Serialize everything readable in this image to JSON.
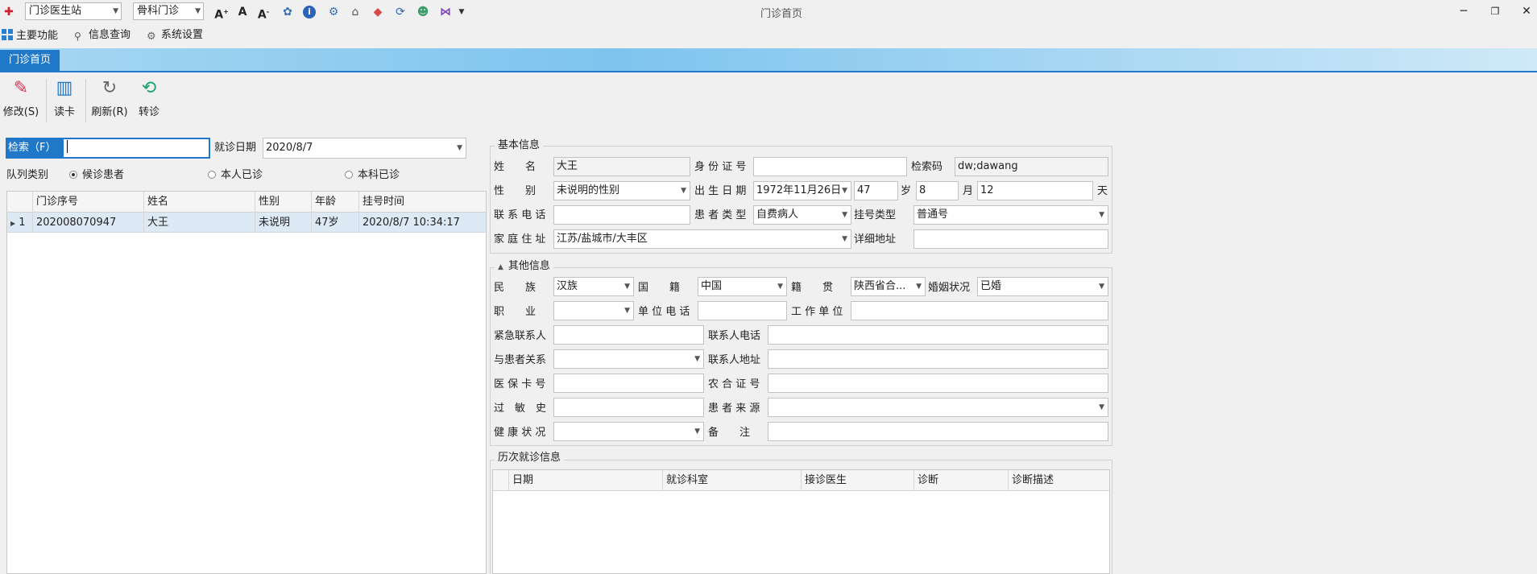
{
  "titlebar": {
    "station": "门诊医生站",
    "department": "骨科门诊",
    "window_title": "门诊首页",
    "icons": [
      "app-logo-icon",
      "font-larger-icon",
      "font-normal-icon",
      "font-smaller-icon",
      "skin-icon",
      "info-icon",
      "settings-icon",
      "home-icon",
      "eraser-icon",
      "sync-icon",
      "user-group-icon",
      "vs-icon"
    ]
  },
  "menubar": {
    "main": "主要功能",
    "query": "信息查询",
    "settings": "系统设置"
  },
  "tabs": {
    "home": "门诊首页"
  },
  "toolbar": {
    "edit": "修改(S)",
    "read_card": "读卡",
    "refresh": "刷新(R)",
    "transfer": "转诊"
  },
  "search": {
    "label": "检索（F）",
    "value": "",
    "date_label": "就诊日期",
    "date_value": "2020/8/7"
  },
  "queue": {
    "label": "队列类别",
    "options": [
      "候诊患者",
      "本人已诊",
      "本科已诊"
    ],
    "selected": 0
  },
  "grid": {
    "columns": [
      "门诊序号",
      "姓名",
      "性别",
      "年龄",
      "挂号时间"
    ],
    "rows": [
      {
        "index": "1",
        "no": "202008070947",
        "name": "大王",
        "sex": "未说明",
        "age": "47岁",
        "time": "2020/8/7 10:34:17"
      }
    ]
  },
  "basic": {
    "title": "基本信息",
    "name_label": "姓　　名",
    "name": "大王",
    "id_label": "身 份 证 号",
    "id": "",
    "code_label": "检索码",
    "code": "dw;dawang",
    "sex_label": "性　　别",
    "sex": "未说明的性别",
    "birth_label": "出 生 日 期",
    "birth": "1972年11月26日",
    "age_years": "47",
    "years_unit": "岁",
    "age_months": "8",
    "months_unit": "月",
    "age_days": "12",
    "days_unit": "天",
    "phone_label": "联 系 电 话",
    "phone": "",
    "ptype_label": "患 者 类 型",
    "ptype": "自费病人",
    "regtype_label": "挂号类型",
    "regtype": "普通号",
    "addr_label": "家 庭 住 址",
    "addr": "江苏/盐城市/大丰区",
    "detail_label": "详细地址",
    "detail": ""
  },
  "other": {
    "title": "其他信息",
    "ethnic_label": "民　　族",
    "ethnic": "汉族",
    "nation_label": "国　　籍",
    "nation": "中国",
    "native_label": "籍　　贯",
    "native": "陕西省合...",
    "marital_label": "婚姻状况",
    "marital": "已婚",
    "job_label": "职　　业",
    "job": "",
    "unitphone_label": "单 位 电 话",
    "unitphone": "",
    "unit_label": "工 作 单 位",
    "unit": "",
    "emerg_label": "紧急联系人",
    "emerg": "",
    "emergphone_label": "联系人电话",
    "emergphone": "",
    "relation_label": "与患者关系",
    "relation": "",
    "contactaddr_label": "联系人地址",
    "contactaddr": "",
    "insure_label": "医 保 卡 号",
    "insure": "",
    "rural_label": "农 合 证 号",
    "rural": "",
    "allergy_label": "过　敏　史",
    "allergy": "",
    "source_label": "患 者 来 源",
    "source": "",
    "health_label": "健 康 状 况",
    "health": "",
    "remark_label": "备　　注",
    "remark": ""
  },
  "history": {
    "title": "历次就诊信息",
    "columns": [
      "日期",
      "就诊科室",
      "接诊医生",
      "诊断",
      "诊断描述"
    ]
  }
}
